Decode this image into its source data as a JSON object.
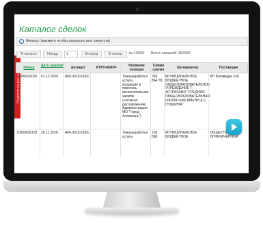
{
  "side_tab": {
    "text": "Подписка на рассылку"
  },
  "page": {
    "title": "Каталог сделок"
  },
  "filter": {
    "text": "Фильтр (нажмите чтобы раскрыть или свернуть)",
    "icon": "refresh-icon"
  },
  "pager": {
    "first": "В начало",
    "prev": "Назад",
    "page": "1",
    "next": "Вперед",
    "last": "В конец",
    "of_text": "из 19650",
    "total_text": "Всего записей: 392993"
  },
  "table": {
    "headers": [
      "Номер",
      "Дата закупки*",
      "Артикул",
      "КТРУ+ЮКР+",
      "Название позиции",
      "Сумма сделки",
      "Организатор",
      "Поставщик"
    ],
    "rows": [
      {
        "number": "UD00031025",
        "date": "01.12.2020",
        "article": "A00.00.00.0001.",
        "ktru": "",
        "name": "Товары(работы/\nуслуги,\nвходящие в\nперечень\nисключительных\nзакупок\n(согласно\nраспоряжению\nАдминистрации\nМО \"Город\nАстрахань\")",
        "sum": "339\n864.78",
        "organizer": "МУНИЦИПАЛЬНОЕ\nБЮДЖЕТНОЕ\nОБЩЕОБРАЗОВАТЕЛЬНОЕ\nУЧРЕЖДЕНИЕ Г.\nАСТРАХАНИ \"СРЕДНЯЯ\nОБЩЕОБРАЗОВАТЕЛЬНАЯ\nШКОЛА №56 ИМЕНИ А.С.\nПУШКИНА\"",
        "supplier": "ИП Болквадзе Л.Ф."
      },
      {
        "number": "UD00030159",
        "date": "30.11.2020",
        "article": "A00.00.00.0001.",
        "ktru": "",
        "name": "Товары(работы/\nуслуги,",
        "sum": "100\n000",
        "organizer": "МУНИЦИПАЛЬНОЕ\nБЮДЖЕТНОЕ",
        "supplier": "ОБЩЕСТВ...\nОГРАНИЧЕННОЙ"
      }
    ]
  },
  "colors": {
    "accent": "#1f9b4a",
    "side_tab": "#d31d1d",
    "play": "#1aa3c7"
  }
}
